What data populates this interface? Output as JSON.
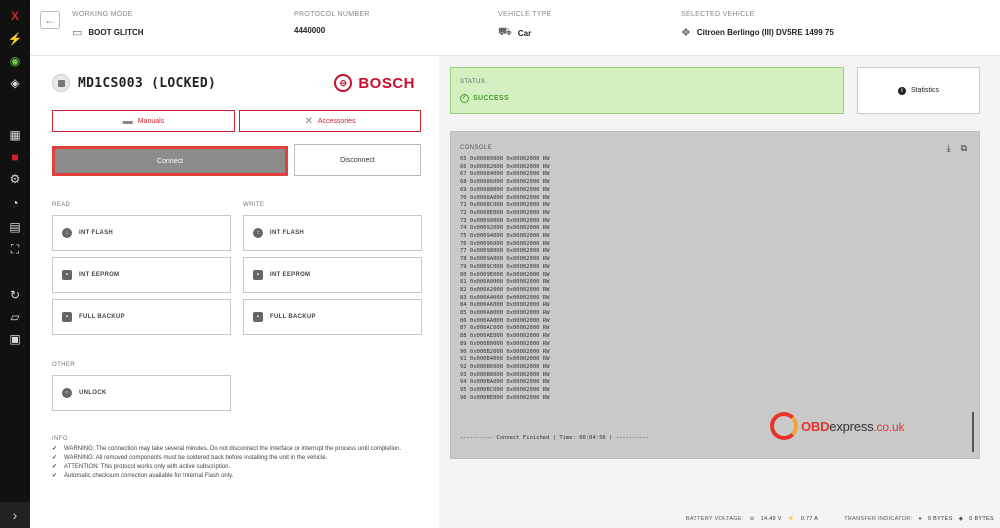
{
  "sidebar": {
    "logo": "X",
    "icons": [
      "usb-icon",
      "globe-icon",
      "cube-icon",
      "grid-icon",
      "chip-icon",
      "gear-icon",
      "gauge-icon",
      "file-icon",
      "expand-icon",
      "history-icon",
      "map-icon",
      "calendar-icon"
    ],
    "collapse": "›"
  },
  "topbar": {
    "working_mode_label": "WORKING MODE",
    "working_mode_value": "BOOT GLITCH",
    "protocol_label": "PROTOCOL NUMBER",
    "protocol_value": "4440000",
    "vehicle_type_label": "VEHICLE TYPE",
    "vehicle_type_value": "Car",
    "selected_vehicle_label": "SELECTED VEHICLE",
    "selected_vehicle_value": "Citroen Berlingo (III) DV5RE 1499 75"
  },
  "ecu": {
    "name": "MD1CS003 (LOCKED)",
    "brand": "BOSCH"
  },
  "buttons": {
    "manuals": "Manuals",
    "accessories": "Accessories",
    "connect": "Connect",
    "disconnect": "Disconnect"
  },
  "read": {
    "label": "READ",
    "int_flash": "INT FLASH",
    "int_eeprom": "INT EEPROM",
    "full_backup": "FULL BACKUP"
  },
  "write": {
    "label": "WRITE",
    "int_flash": "INT FLASH",
    "int_eeprom": "INT EEPROM",
    "full_backup": "FULL BACKUP"
  },
  "other": {
    "label": "OTHER",
    "unlock": "UNLOCK"
  },
  "info": {
    "label": "INFO",
    "items": [
      "WARNING: The connection may take several minutes. Do not disconnect the interface or interrupt the process until completion.",
      "WARNING: All removed components must be soldered back before installing the unit in the vehicle.",
      "ATTENTION: This protocol works only with active subscription.",
      "Automatic checksum correction available for Internal Flash only."
    ]
  },
  "status": {
    "label": "STATUS",
    "value": "SUCCESS"
  },
  "statistics_label": "Statistics",
  "console": {
    "label": "CONSOLE",
    "lines": [
      "65 0x00080000 0x00002000 RW",
      "66 0x00082000 0x00002000 RW",
      "67 0x00084000 0x00002000 RW",
      "68 0x00086000 0x00002000 RW",
      "69 0x00088000 0x00002000 RW",
      "70 0x0008A000 0x00002000 RW",
      "71 0x0008C000 0x00002000 RW",
      "72 0x0008E000 0x00002000 RW",
      "73 0x00090000 0x00002000 RW",
      "74 0x00092000 0x00002000 RW",
      "75 0x00094000 0x00002000 RW",
      "76 0x00096000 0x00002000 RW",
      "77 0x00098000 0x00002000 RW",
      "78 0x0009A000 0x00002000 RW",
      "79 0x0009C000 0x00002000 RW",
      "80 0x0009E000 0x00002000 RW",
      "81 0x000A0000 0x00002000 RW",
      "82 0x000A2000 0x00002000 RW",
      "83 0x000A4000 0x00002000 RW",
      "84 0x000A6000 0x00002000 RW",
      "85 0x000A8000 0x00002000 RW",
      "86 0x000AA000 0x00002000 RW",
      "87 0x000AC000 0x00002000 RW",
      "88 0x000AE000 0x00002000 RW",
      "89 0x000B0000 0x00002000 RW",
      "90 0x000B2000 0x00002000 RW",
      "91 0x000B4000 0x00002000 RW",
      "92 0x000B6000 0x00002000 RW",
      "93 0x000B8000 0x00002000 RW",
      "94 0x000BA000 0x00002000 RW",
      "95 0x000BC000 0x00002000 RW",
      "96 0x000BE000 0x00002000 RW"
    ],
    "finished": "---------- Connect Finished ( Time: 00:04:56 ) ----------"
  },
  "watermark": {
    "brand": "OBD",
    "name": "express",
    "domain": ".co.uk"
  },
  "footer": {
    "battery_label": "BATTERY VOLTAGE:",
    "battery_value": "14.49 V",
    "current_value": "0.77 A",
    "transfer_label": "TRANSFER INDICATOR:",
    "transfer_up": "0 BYTES",
    "transfer_down": "0 BYTES"
  },
  "colors": {
    "accent_red": "#d4202e",
    "status_green_bg": "#d4f0c0",
    "status_green_text": "#4a9a2a",
    "console_bg": "#c9c9c9"
  }
}
